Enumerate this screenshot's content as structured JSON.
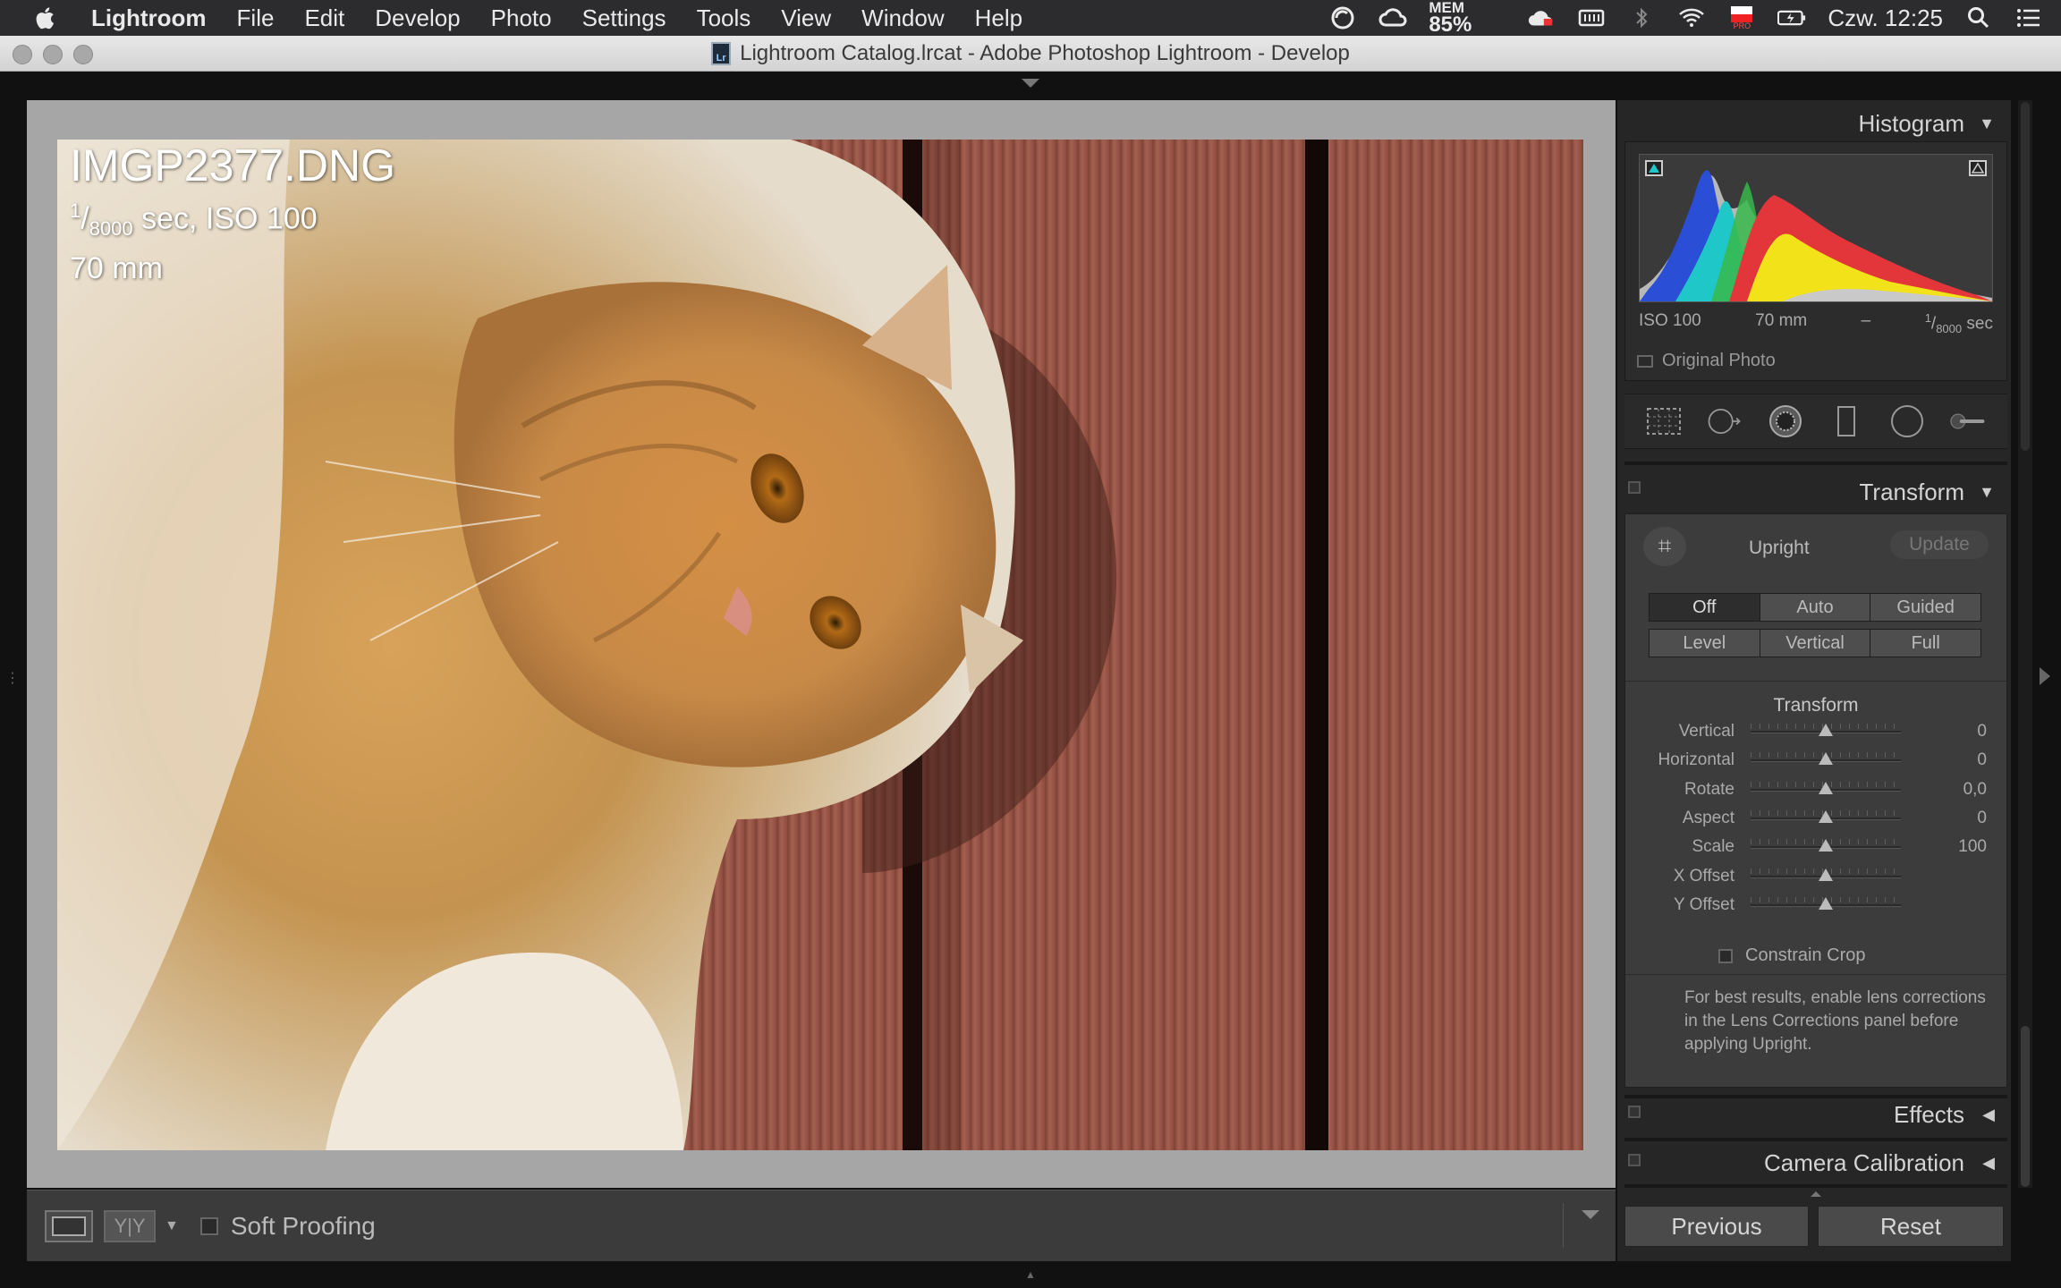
{
  "menubar": {
    "items": [
      "Lightroom",
      "File",
      "Edit",
      "Develop",
      "Photo",
      "Settings",
      "Tools",
      "View",
      "Window",
      "Help"
    ],
    "mem_label": "MEM",
    "mem_value": "85%",
    "flag_label": "PRO",
    "clock": "Czw. 12:25"
  },
  "window": {
    "title": "Lightroom Catalog.lrcat - Adobe Photoshop Lightroom - Develop",
    "doc_icon_text": "Lr"
  },
  "photo_info": {
    "filename": "IMGP2377.DNG",
    "shutter_num": "1",
    "shutter_den": "8000",
    "exposure_rest": " sec, ISO 100",
    "focal": "70 mm"
  },
  "toolbar": {
    "yy_label": "Y|Y",
    "soft_proofing": "Soft Proofing"
  },
  "histogram": {
    "title": "Histogram",
    "iso": "ISO 100",
    "focal": "70 mm",
    "aperture": "–",
    "shutter_num": "1",
    "shutter_den": "8000",
    "shutter_unit": " sec",
    "original_photo": "Original Photo"
  },
  "tools": [
    "crop-tool",
    "spot-removal-tool",
    "red-eye-tool",
    "graduated-filter-tool",
    "radial-filter-tool",
    "adjustment-brush-tool"
  ],
  "transform": {
    "title": "Transform",
    "upright_label": "Upright",
    "update_label": "Update",
    "upright_row1": [
      "Off",
      "Auto",
      "Guided"
    ],
    "upright_row2": [
      "Level",
      "Vertical",
      "Full"
    ],
    "selected": "Off",
    "section_title": "Transform",
    "sliders": [
      {
        "label": "Vertical",
        "value": "0",
        "pos": 0.5
      },
      {
        "label": "Horizontal",
        "value": "0",
        "pos": 0.5
      },
      {
        "label": "Rotate",
        "value": "0,0",
        "pos": 0.5
      },
      {
        "label": "Aspect",
        "value": "0",
        "pos": 0.5
      },
      {
        "label": "Scale",
        "value": "100",
        "pos": 0.5
      },
      {
        "label": "X Offset",
        "value": "",
        "pos": 0.5
      },
      {
        "label": "Y Offset",
        "value": "",
        "pos": 0.5
      }
    ],
    "constrain_crop": "Constrain Crop",
    "note": "For best results, enable lens corrections in the Lens Corrections panel before applying Upright."
  },
  "panels": {
    "effects": "Effects",
    "camera_calibration": "Camera Calibration"
  },
  "buttons": {
    "previous": "Previous",
    "reset": "Reset"
  },
  "colors": {
    "panel_bg": "#3c3c3c",
    "canvas_bg": "#a6a6a6",
    "histogram_red": "#e2363b",
    "histogram_yellow": "#f2e21a",
    "histogram_cyan": "#1fc7c9",
    "histogram_blue": "#2a4fd6",
    "histogram_green": "#37b84a"
  }
}
